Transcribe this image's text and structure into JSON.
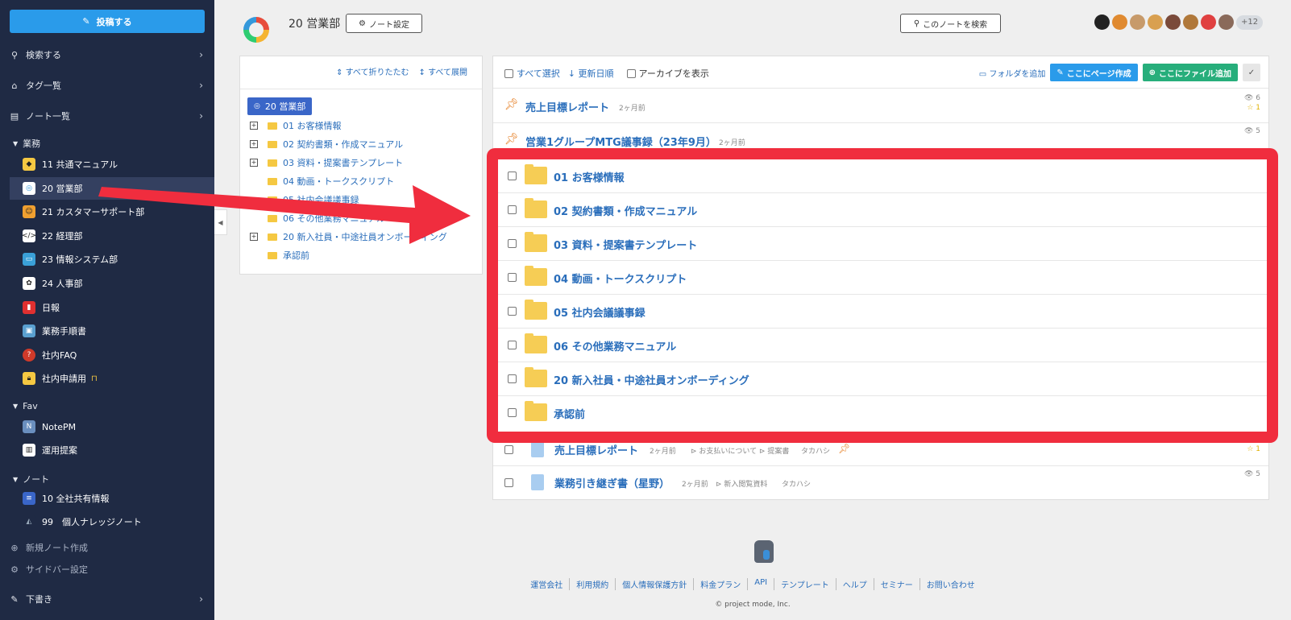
{
  "sidebar": {
    "post_button": "投稿する",
    "search": "検索する",
    "tags": "タグ一覧",
    "notes": "ノート一覧",
    "groups": [
      {
        "label": "業務",
        "items": [
          {
            "label": "11 共通マニュアル",
            "icon": "shield-icon"
          },
          {
            "label": "20 営業部",
            "icon": "ring-icon",
            "active": true
          },
          {
            "label": "21 カスタマーサポート部",
            "icon": "person-icon"
          },
          {
            "label": "22 経理部",
            "icon": "code-icon"
          },
          {
            "label": "23 情報システム部",
            "icon": "monitor-icon"
          },
          {
            "label": "24 人事部",
            "icon": "palette-icon"
          },
          {
            "label": "日報",
            "icon": "book-icon"
          },
          {
            "label": "業務手順書",
            "icon": "screen-icon"
          },
          {
            "label": "社内FAQ",
            "icon": "question-icon"
          },
          {
            "label": "社内申請用",
            "icon": "lock-icon"
          }
        ]
      },
      {
        "label": "Fav",
        "items": [
          {
            "label": "NotePM",
            "icon": "notepm-icon"
          },
          {
            "label": "運用提案",
            "icon": "chart-icon"
          }
        ]
      },
      {
        "label": "ノート",
        "items": [
          {
            "label": "10 全社共有情報",
            "icon": "document-icon"
          },
          {
            "label": "99　個人ナレッジノート",
            "icon": "hat-icon"
          }
        ]
      }
    ],
    "new_note": "新規ノート作成",
    "sidebar_settings": "サイドバー設定",
    "drafts": "下書き"
  },
  "header": {
    "title": "20 営業部",
    "settings_button": "ノート設定",
    "search_button": "このノートを検索",
    "more_members": "+12"
  },
  "tree": {
    "collapse_all": "すべて折りたたむ",
    "expand_all": "すべて展開",
    "root": "20 営業部",
    "items": [
      {
        "label": "01 お客様情報",
        "expandable": true
      },
      {
        "label": "02 契約書類・作成マニュアル",
        "expandable": true
      },
      {
        "label": "03 資料・提案書テンプレート",
        "expandable": true
      },
      {
        "label": "04 動画・トークスクリプト",
        "expandable": false
      },
      {
        "label": "05 社内会議議事録",
        "expandable": false
      },
      {
        "label": "06 その他業務マニュアル",
        "expandable": false
      },
      {
        "label": "20 新入社員・中途社員オンボーディング",
        "expandable": true
      },
      {
        "label": "承認前",
        "expandable": false
      }
    ]
  },
  "list": {
    "select_all": "すべて選択",
    "sort": "更新日順",
    "show_archive": "アーカイブを表示",
    "add_folder": "フォルダを追加",
    "create_page": "ここにページ作成",
    "add_file": "ここにファイル追加",
    "pinned": [
      {
        "title": "売上目標レポート",
        "time": "2ヶ月前",
        "views": "6",
        "stars": "1"
      },
      {
        "title": "営業1グループMTG議事録（23年9月）",
        "time": "2ヶ月前",
        "views": "5"
      }
    ],
    "folders": [
      "01 お客様情報",
      "02 契約書類・作成マニュアル",
      "03 資料・提案書テンプレート",
      "04 動画・トークスクリプト",
      "05 社内会議議事録",
      "06 その他業務マニュアル",
      "20 新入社員・中途社員オンボーディング",
      "承認前"
    ],
    "pages": [
      {
        "title": "売上目標レポート",
        "time": "2ヶ月前",
        "tag1": "お支払いについて",
        "tag2": "提案書",
        "author": "タカハシ",
        "stars": "1"
      },
      {
        "title": "業務引き継ぎ書（星野）",
        "time": "2ヶ月前",
        "tag1": "新入閲覧資料",
        "author": "タカハシ",
        "views": "5"
      }
    ]
  },
  "footer": {
    "links": [
      "運営会社",
      "利用規約",
      "個人情報保護方針",
      "料金プラン",
      "API",
      "テンプレート",
      "ヘルプ",
      "セミナー",
      "お問い合わせ"
    ],
    "copyright": "© project mode, Inc."
  },
  "colors": {
    "sidebar_bg": "#1f2a44",
    "accent_blue": "#2a9bea",
    "accent_green": "#27ae7b",
    "highlight_red": "#f02d3e",
    "folder_yellow": "#f6cd55"
  }
}
